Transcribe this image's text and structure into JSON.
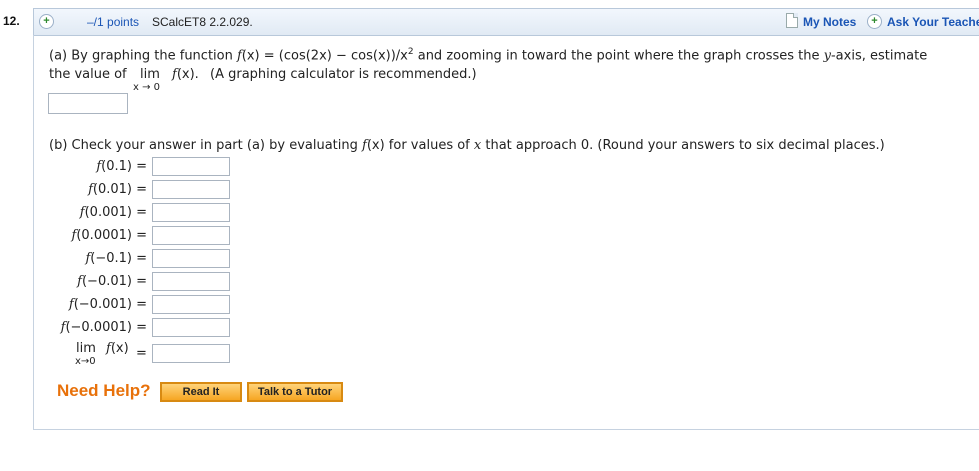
{
  "question": {
    "number": "12.",
    "points": "–/1 points",
    "code": "SCalcET8 2.2.029.",
    "my_notes": "My Notes",
    "ask_teacher": "Ask Your Teacher"
  },
  "part_a": {
    "line1_pre": "(a) By graphing the function ",
    "fx": "f",
    "line1_eq": "(x) = (cos(2x) − cos(x))/x",
    "sup": "2",
    "line1_post": " and zooming in toward the point where the graph crosses the ",
    "yaxis": "y",
    "line1_end": "-axis, estimate",
    "line2_pre": "the value of",
    "lim": "lim",
    "lim_sub": "x → 0",
    "lim_f": "f",
    "lim_fx": "(x).",
    "line2_post": "(A graphing calculator is recommended.)",
    "answer_value": ""
  },
  "part_b": {
    "instruction_pre": "(b) Check your answer in part (a) by evaluating ",
    "f": "f",
    "fx": "(x)",
    "instruction_mid": " for values of ",
    "x": "x",
    "instruction_post": " that approach 0. (Round your answers to six decimal places.)",
    "rows": [
      {
        "label": "(0.1)  =",
        "value": ""
      },
      {
        "label": "(0.01)  =",
        "value": ""
      },
      {
        "label": "(0.001)  =",
        "value": ""
      },
      {
        "label": "(0.0001)  =",
        "value": ""
      },
      {
        "label": "(−0.1)  =",
        "value": ""
      },
      {
        "label": "(−0.01)  =",
        "value": ""
      },
      {
        "label": "(−0.001)  =",
        "value": ""
      },
      {
        "label": "(−0.0001)  =",
        "value": ""
      }
    ],
    "lim_label": "lim",
    "lim_fx": "(x)",
    "lim_sub": "x→0",
    "lim_eq": "=",
    "lim_value": ""
  },
  "help": {
    "need_help": "Need Help?",
    "read_it": "Read It",
    "talk_tutor": "Talk to a Tutor"
  },
  "colors": {
    "link_blue": "#1a55b5",
    "help_orange": "#e8710a",
    "button_orange": "#f6a623"
  }
}
